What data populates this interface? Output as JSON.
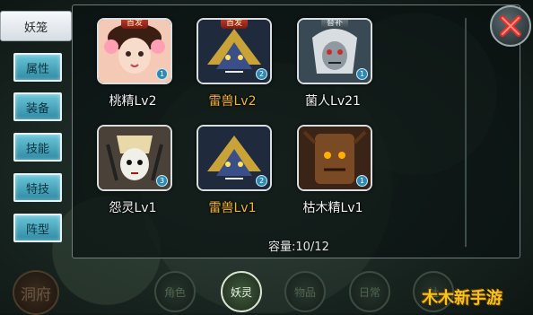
{
  "top_tab": "妖笼",
  "side_menu": [
    {
      "label": "属性"
    },
    {
      "label": "装备"
    },
    {
      "label": "技能"
    },
    {
      "label": "特技"
    },
    {
      "label": "阵型"
    }
  ],
  "pets": [
    {
      "name": "桃精Lv2",
      "badge": "首发",
      "slot": "1",
      "name_color": "white"
    },
    {
      "name": "雷兽Lv2",
      "badge": "首发",
      "slot": "2",
      "name_color": "gold"
    },
    {
      "name": "菌人Lv21",
      "badge": "替补",
      "slot": "1",
      "name_color": "white"
    },
    {
      "name": "怨灵Lv1",
      "badge": "",
      "slot": "3",
      "name_color": "white"
    },
    {
      "name": "雷兽Lv1",
      "badge": "",
      "slot": "2",
      "name_color": "gold"
    },
    {
      "name": "枯木精Lv1",
      "badge": "",
      "slot": "1",
      "name_color": "white"
    }
  ],
  "capacity": "容量:10/12",
  "bottom_nav": [
    {
      "label": "洞府"
    },
    {
      "label": "角色"
    },
    {
      "label": "妖灵",
      "active": true
    },
    {
      "label": "物品"
    },
    {
      "label": "日常"
    },
    {
      "label": "社"
    }
  ],
  "watermark": "木木新手游",
  "colors": {
    "accent_side": "#2e8aa3",
    "gold_name": "#f0b23e",
    "close_red": "#e0302a"
  }
}
